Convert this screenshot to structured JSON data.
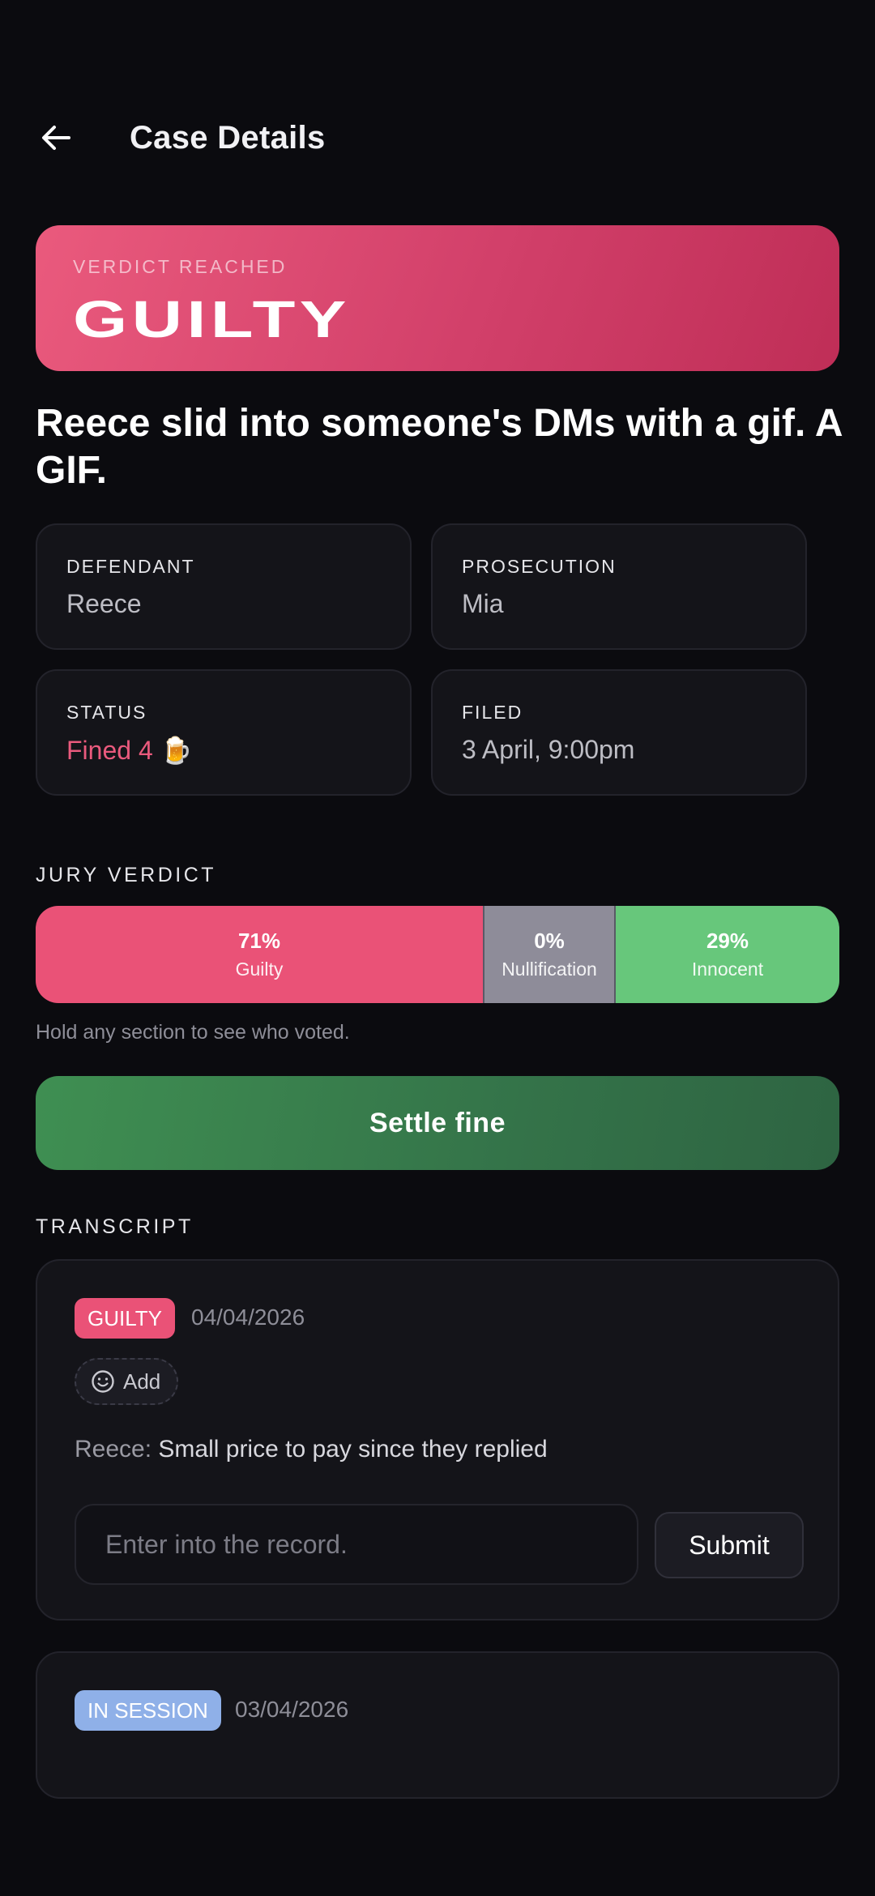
{
  "header": {
    "title": "Case Details",
    "back_icon": "arrow-left-icon"
  },
  "verdict": {
    "label": "VERDICT REACHED",
    "value": "GUILTY"
  },
  "case": {
    "title": "Reece slid into someone's DMs with a gif. A GIF."
  },
  "info": {
    "defendant": {
      "label": "DEFENDANT",
      "value": "Reece"
    },
    "prosecution": {
      "label": "PROSECUTION",
      "value": "Mia"
    },
    "status": {
      "label": "STATUS",
      "value": "Fined 4 🍺"
    },
    "filed": {
      "label": "FILED",
      "value": "3 April, 9:00pm"
    }
  },
  "jury": {
    "label": "JURY VERDICT",
    "segments": [
      {
        "pct": "71%",
        "label": "Guilty",
        "share": 0.71
      },
      {
        "pct": "0%",
        "label": "Nullification",
        "share": 0.0
      },
      {
        "pct": "29%",
        "label": "Innocent",
        "share": 0.29
      }
    ],
    "hint": "Hold any section to see who voted."
  },
  "actions": {
    "settle_label": "Settle fine"
  },
  "transcript": {
    "label": "TRANSCRIPT",
    "entries": [
      {
        "badge": "GUILTY",
        "date": "04/04/2026",
        "react_label": "Add",
        "speaker": "Reece:",
        "message": "Small price to pay since they replied",
        "input_placeholder": "Enter into the record.",
        "submit_label": "Submit"
      },
      {
        "badge": "IN SESSION",
        "date": "03/04/2026"
      }
    ]
  },
  "colors": {
    "guilty": "#ea5277",
    "nullification": "#8e8c99",
    "innocent": "#67c77b",
    "in_session": "#8fb0e8",
    "settle": "#3f8f52"
  }
}
